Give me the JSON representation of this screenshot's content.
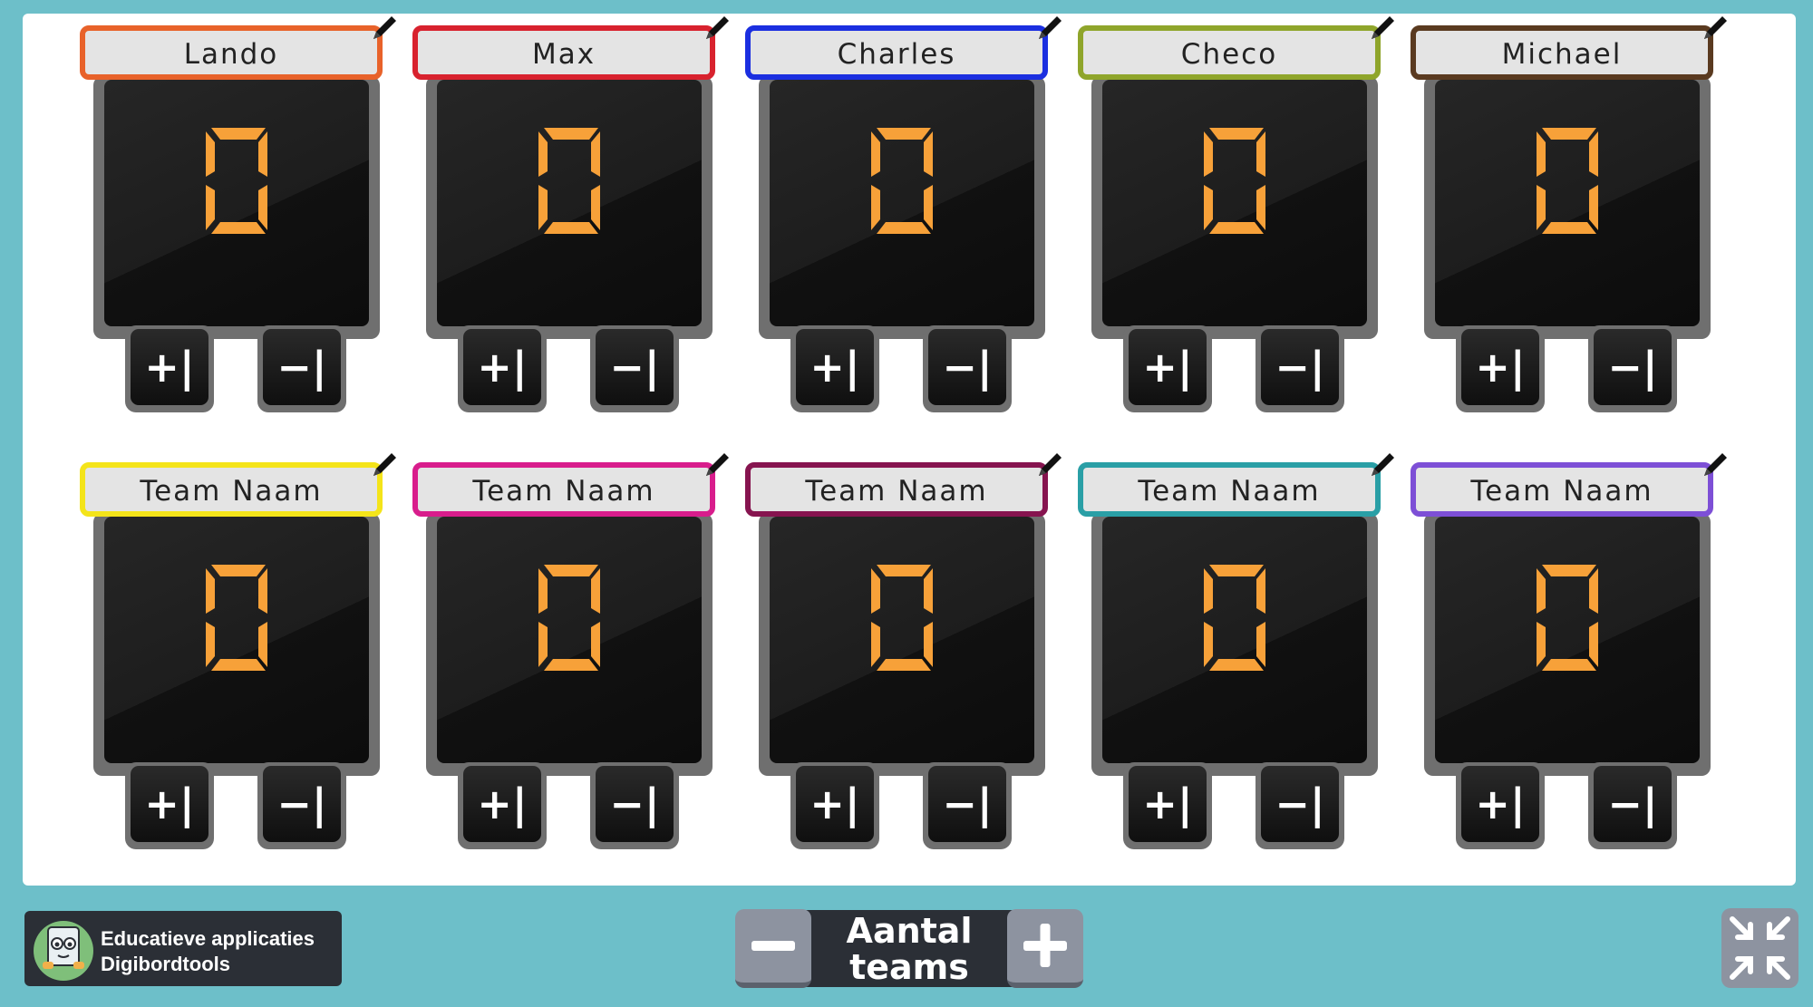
{
  "teams": [
    {
      "name": "Lando",
      "score": "0",
      "color": "#e8622a"
    },
    {
      "name": "Max",
      "score": "0",
      "color": "#d8222e"
    },
    {
      "name": "Charles",
      "score": "0",
      "color": "#1b2fe0"
    },
    {
      "name": "Checo",
      "score": "0",
      "color": "#8fa52b"
    },
    {
      "name": "Michael",
      "score": "0",
      "color": "#5a3a20"
    },
    {
      "name": "Team Naam",
      "score": "0",
      "color": "#f4e41a"
    },
    {
      "name": "Team Naam",
      "score": "0",
      "color": "#d81d8c"
    },
    {
      "name": "Team Naam",
      "score": "0",
      "color": "#86144f"
    },
    {
      "name": "Team Naam",
      "score": "0",
      "color": "#2a9fa6"
    },
    {
      "name": "Team Naam",
      "score": "0",
      "color": "#7d4fd6"
    }
  ],
  "buttons": {
    "plus": "+|",
    "minus": "−|"
  },
  "digit_color": "#f7a139",
  "footer": {
    "brand_line1": "Educatieve applicaties",
    "brand_line2": "Digibordtools",
    "teams_label_line1": "Aantal",
    "teams_label_line2": "teams"
  },
  "icons": {
    "edit": "pencil-icon",
    "fullscreen": "fullscreen-exit-icon",
    "decrease": "minus-icon",
    "increase": "plus-icon",
    "mascot": "book-mascot-icon"
  }
}
